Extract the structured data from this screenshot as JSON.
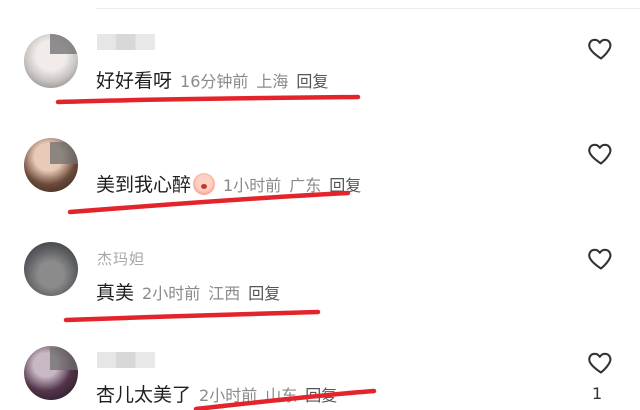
{
  "comments": [
    {
      "username": "",
      "text": "好好看呀",
      "time": "16分钟前",
      "location": "上海",
      "reply": "回复",
      "likes": ""
    },
    {
      "username": "",
      "text": "美到我心醉",
      "time": "1小时前",
      "location": "广东",
      "reply": "回复",
      "likes": "",
      "emoji": "scared-face-emoji"
    },
    {
      "username": "杰玛妲",
      "text": "真美",
      "time": "2小时前",
      "location": "江西",
      "reply": "回复",
      "likes": ""
    },
    {
      "username": "",
      "text": "杏儿太美了",
      "time": "2小时前",
      "location": "山东",
      "reply": "回复",
      "likes": "1"
    }
  ],
  "icons": {
    "like": "heart-outline-icon"
  },
  "colors": {
    "underline": "#e3242b",
    "meta": "#8a8a8a",
    "text": "#1f1f1f"
  }
}
